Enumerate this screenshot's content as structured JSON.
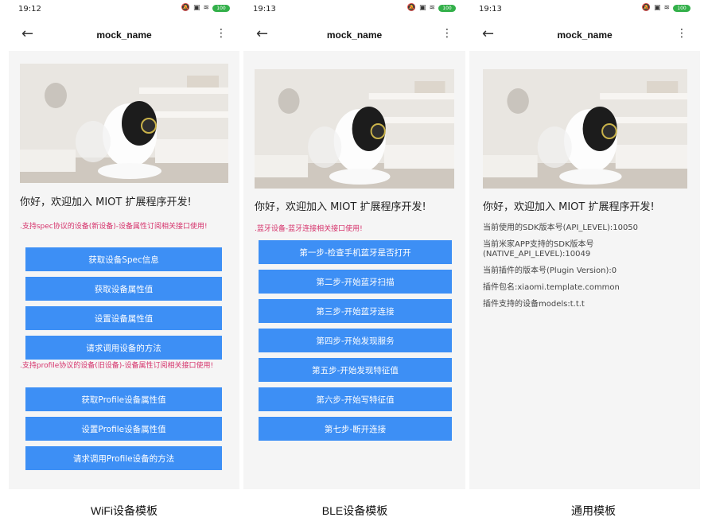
{
  "screens": [
    {
      "time": "19:12",
      "title": "mock_name",
      "welcome": "你好，欢迎加入 MIOT 扩展程序开发!",
      "note1": ".支持spec协议的设备(新设备)-设备属性订阅相关接口使用!",
      "buttons1": [
        "获取设备Spec信息",
        "获取设备属性值",
        "设置设备属性值",
        "请求调用设备的方法"
      ],
      "note2": ".支持profile协议的设备(旧设备)-设备属性订阅相关接口使用!",
      "buttons2": [
        "获取Profile设备属性值",
        "设置Profile设备属性值",
        "请求调用Profile设备的方法"
      ],
      "caption": "WiFi设备模板"
    },
    {
      "time": "19:13",
      "title": "mock_name",
      "welcome": "你好，欢迎加入 MIOT 扩展程序开发!",
      "note1": ".蓝牙设备-蓝牙连接相关接口使用!",
      "buttons1": [
        "第一步-检查手机蓝牙是否打开",
        "第二步-开始蓝牙扫描",
        "第三步-开始蓝牙连接",
        "第四步-开始发现服务",
        "第五步-开始发现特征值",
        "第六步-开始写特征值",
        "第七步-断开连接"
      ],
      "caption": "BLE设备模板"
    },
    {
      "time": "19:13",
      "title": "mock_name",
      "welcome": "你好，欢迎加入 MIOT 扩展程序开发!",
      "info": [
        "当前使用的SDK版本号(API_LEVEL):10050",
        "当前米家APP支持的SDK版本号(NATIVE_API_LEVEL):10049",
        "当前插件的版本号(Plugin Version):0",
        "插件包名:xiaomi.template.common",
        "插件支持的设备models:t.t.t"
      ],
      "caption": "通用模板"
    }
  ],
  "statusbar": {
    "battery": "100",
    "icons": [
      "bluetooth-icon",
      "mute-icon",
      "screen-icon",
      "wifi-icon",
      "battery-icon"
    ]
  },
  "icons": {
    "back": "arrow-left-icon",
    "more": "more-vertical-icon"
  },
  "colors": {
    "button": "#3d8ff5",
    "note": "#d6336c",
    "background": "#f5f5f5"
  }
}
